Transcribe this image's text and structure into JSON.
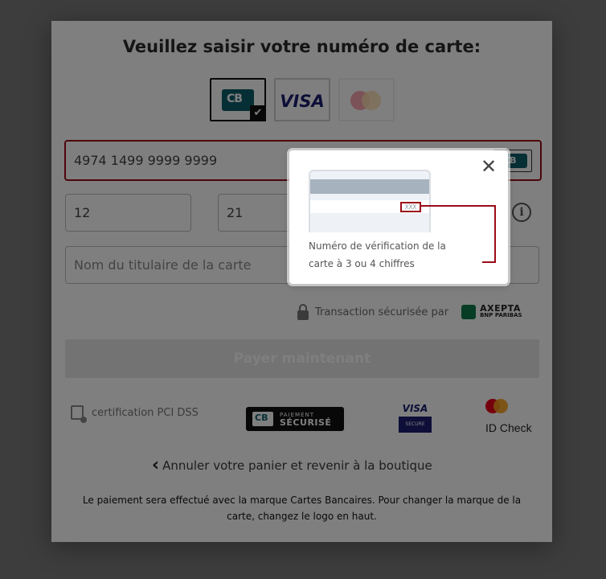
{
  "title": "Veuillez saisir votre numéro de carte:",
  "brands": {
    "cb_logo": "CB",
    "visa_logo": "VISA"
  },
  "card": {
    "number": "4974 1499 9999 9999",
    "mini_logo": "CB"
  },
  "expiry": {
    "month": "12",
    "year": "21"
  },
  "cardholder": {
    "placeholder": "Nom du titulaire de la carte"
  },
  "info_icon": "i",
  "secure": {
    "text": "Transaction sécurisée par",
    "axepta": "AXEPTA",
    "axepta_sub": "BNP PARIBAS"
  },
  "pay_button": "Payer maintenant",
  "badges": {
    "pci": "certification PCI DSS",
    "paiement_line1": "PAIEMENT",
    "paiement_line2": "SÉCURISÉ",
    "visa_secure_top": "VISA",
    "visa_secure_bottom": "SECURE",
    "idcheck": "ID Check"
  },
  "cancel": "Annuler votre panier et revenir à la boutique",
  "footer_note": "Le paiement sera effectué avec la marque Cartes Bancaires. Pour changer la marque de la carte, changez le logo en haut.",
  "popup": {
    "close": "✕",
    "cvv_sample": "XXX",
    "description": "Numéro de vérification de la carte à 3 ou 4 chiffres"
  },
  "colors": {
    "error_border": "#9b0b18",
    "cb_green": "#0d5f6a",
    "visa_blue": "#1a1f71"
  }
}
